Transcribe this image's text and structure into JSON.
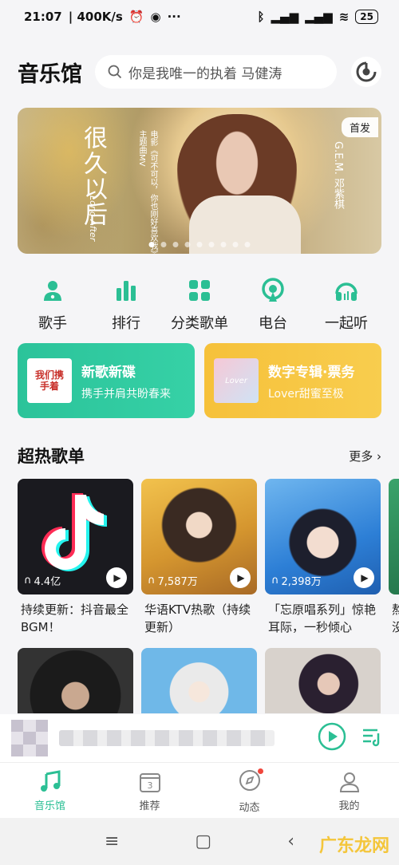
{
  "status": {
    "time": "21:07",
    "speed": "400K/s",
    "battery": "25"
  },
  "header": {
    "title": "音乐馆",
    "search_placeholder": "你是我唯一的执着 马健涛"
  },
  "banner": {
    "title": "很久以后",
    "subtitle_lines": [
      "电影《可不可以，你也刚好喜欢我》主题曲MV"
    ],
    "english": "Long After",
    "artist": "G.E.M. 邓紫棋",
    "badge": "首发",
    "dot_count": 9,
    "active_dot": 0
  },
  "categories": [
    {
      "label": "歌手",
      "icon": "singer-icon"
    },
    {
      "label": "排行",
      "icon": "chart-bars-icon"
    },
    {
      "label": "分类歌单",
      "icon": "grid-icon"
    },
    {
      "label": "电台",
      "icon": "radio-icon"
    },
    {
      "label": "一起听",
      "icon": "headphones-icon"
    }
  ],
  "promo_cards": [
    {
      "title": "新歌新碟",
      "subtitle": "携手并肩共盼春来",
      "thumb_text": "我们携手着",
      "color": "#2bc39a"
    },
    {
      "title": "数字专辑·票务",
      "subtitle": "Lover甜蜜至极",
      "thumb_text": "Lover",
      "color": "#f6c13a"
    }
  ],
  "hot_section": {
    "title": "超热歌单",
    "more": "更多"
  },
  "playlists": [
    {
      "count": "4.4亿",
      "title": "持续更新：抖音最全BGM！"
    },
    {
      "count": "7,587万",
      "title": "华语KTV热歌（持续更新）"
    },
    {
      "count": "2,398万",
      "title": "「忘原唱系列」惊艳耳际，一秒倾心"
    },
    {
      "count": "",
      "title": "熬没"
    }
  ],
  "tabs": [
    {
      "label": "音乐馆",
      "icon": "music-note-icon",
      "active": true
    },
    {
      "label": "推荐",
      "icon": "calendar-icon",
      "badge_text": "3",
      "active": false
    },
    {
      "label": "动态",
      "icon": "compass-icon",
      "active": false
    },
    {
      "label": "我的",
      "icon": "person-icon",
      "active": false
    }
  ],
  "watermark": "广东龙网",
  "colors": {
    "accent": "#2bbf94",
    "background": "#f5f5f7"
  }
}
